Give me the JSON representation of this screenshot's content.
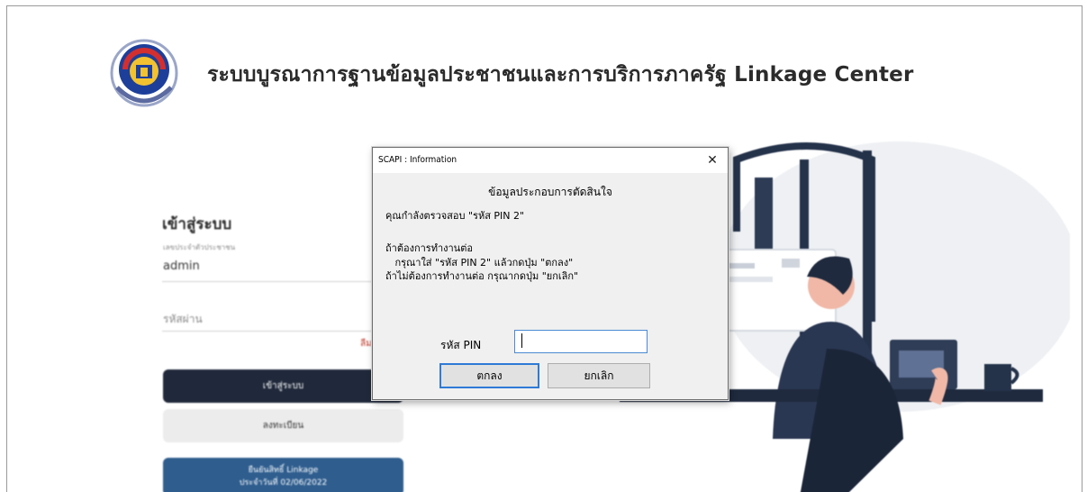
{
  "header": {
    "title": "ระบบบูรณาการฐานข้อมูลประชาชนและการบริการภาครัฐ Linkage Center",
    "logo_icon": "department-seal-logo"
  },
  "login": {
    "heading": "เข้าสู่ระบบ",
    "username_label": "เลขประจำตัวประชาชน",
    "username_value": "admin",
    "password_label": "รหัสผ่าน",
    "forgot_link": "ลืม",
    "login_button": "เข้าสู่ระบบ",
    "register_button": "ลงทะเบียน",
    "notice_button_line1": "ยืนยันสิทธิ์ Linkage",
    "notice_button_line2": "ประจำวันที่ 02/06/2022"
  },
  "dialog": {
    "title": "SCAPI : Information",
    "close_symbol": "✕",
    "heading": "ข้อมูลประกอบการตัดสินใจ",
    "line1": "คุณกำลังตรวจสอบ \"รหัส PIN 2\"",
    "line2": "ถ้าต้องการทำงานต่อ",
    "line3": "   กรุณาใส่ \"รหัส PIN 2\" แล้วกดปุ่ม \"ตกลง\"",
    "line4": "ถ้าไม่ต้องการทำงานต่อ กรุณากดปุ่ม \"ยกเลิก\"",
    "pin_label": "รหัส PIN",
    "pin_value": "",
    "ok_button": "ตกลง",
    "cancel_button": "ยกเลิก"
  },
  "colors": {
    "navy": "#20293b",
    "notice_blue": "#2e5d8e",
    "dialog_bg": "#f0f0f0",
    "focus_blue": "#2f7ad6"
  }
}
